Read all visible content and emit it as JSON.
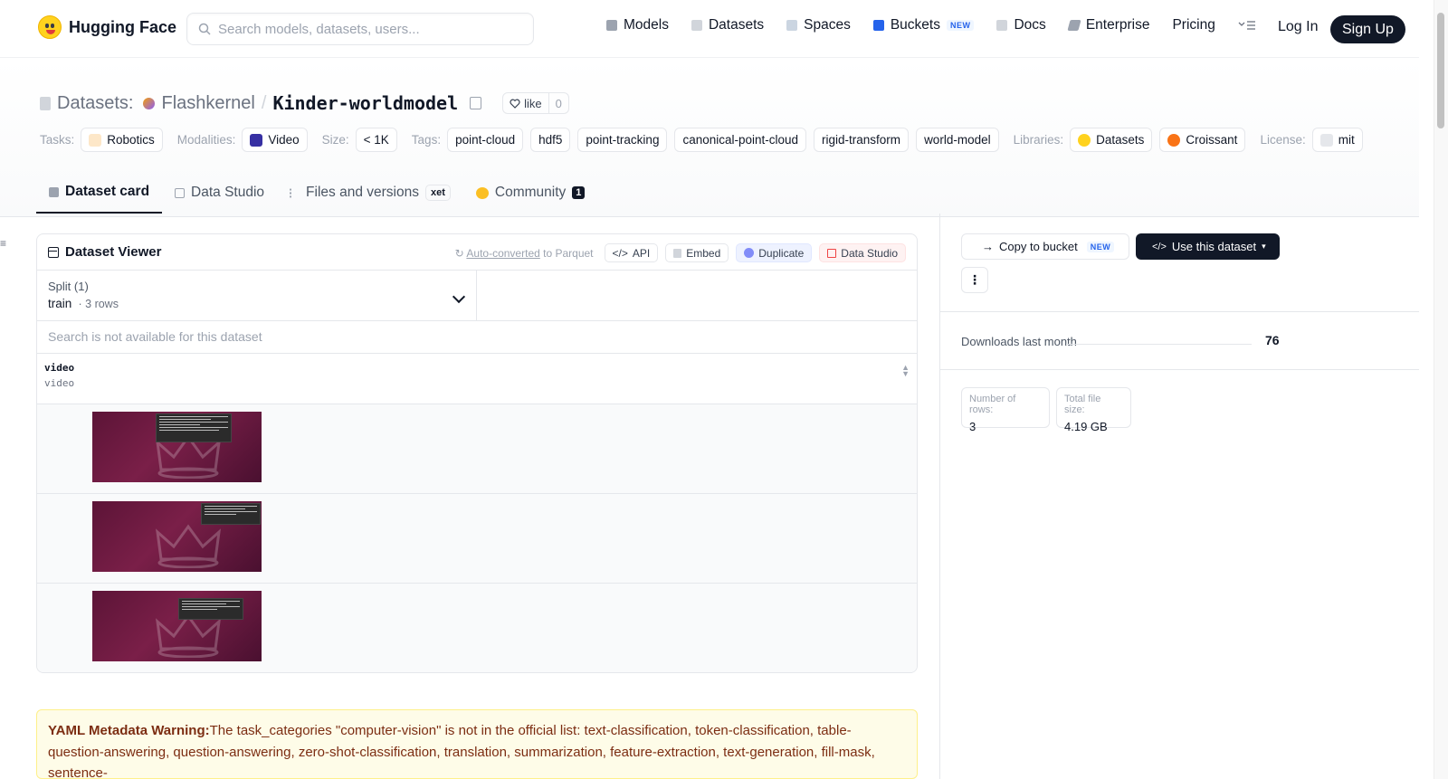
{
  "nav": {
    "brand": "Hugging Face",
    "search_placeholder": "Search models, datasets, users...",
    "links": {
      "models": "Models",
      "datasets": "Datasets",
      "spaces": "Spaces",
      "buckets": "Buckets",
      "buckets_badge": "NEW",
      "docs": "Docs",
      "enterprise": "Enterprise",
      "pricing": "Pricing"
    },
    "login": "Log In",
    "signup": "Sign Up"
  },
  "repo": {
    "section": "Datasets:",
    "owner": "Flashkernel",
    "separator": "/",
    "name": "Kinder-worldmodel",
    "like_label": "like",
    "like_count": "0"
  },
  "tags": {
    "tasks_label": "Tasks:",
    "tasks": [
      "Robotics"
    ],
    "modalities_label": "Modalities:",
    "modalities": [
      "Video"
    ],
    "size_label": "Size:",
    "size": "< 1K",
    "tags_label": "Tags:",
    "tags": [
      "point-cloud",
      "hdf5",
      "point-tracking",
      "canonical-point-cloud",
      "rigid-transform",
      "world-model"
    ],
    "libraries_label": "Libraries:",
    "libraries": [
      "Datasets",
      "Croissant"
    ],
    "license_label": "License:",
    "license": "mit"
  },
  "tabs": {
    "card": "Dataset card",
    "studio": "Data Studio",
    "files": "Files and versions",
    "files_badge": "xet",
    "community": "Community",
    "community_count": "1"
  },
  "viewer": {
    "title": "Dataset Viewer",
    "auto_converted": "Auto-converted",
    "to_parquet": " to Parquet",
    "api": "API",
    "embed": "Embed",
    "duplicate": "Duplicate",
    "data_studio": "Data Studio",
    "split_label": "Split (1)",
    "split_value": "train",
    "split_rows": "3 rows",
    "search_note": "Search is not available for this dataset",
    "column_name": "video",
    "column_type": "video"
  },
  "sidebar": {
    "copy_to_bucket": "Copy to bucket",
    "copy_badge": "NEW",
    "use_dataset": "Use this dataset",
    "more": "⋮",
    "downloads_label": "Downloads last month",
    "downloads_value": "76",
    "rows_label": "Number of rows:",
    "rows_value": "3",
    "size_label": "Total file size:",
    "size_value": "4.19 GB"
  },
  "warning": {
    "title": "YAML Metadata Warning:",
    "text": "The task_categories \"computer-vision\" is not in the official list: text-classification, token-classification, table-question-answering, question-answering, zero-shot-classification, translation, summarization, feature-extraction, text-generation, fill-mask, sentence-"
  },
  "colors": {
    "accent_dark": "#111827",
    "warning_bg": "#fefce8",
    "thumb_purple": "#5c1437"
  }
}
